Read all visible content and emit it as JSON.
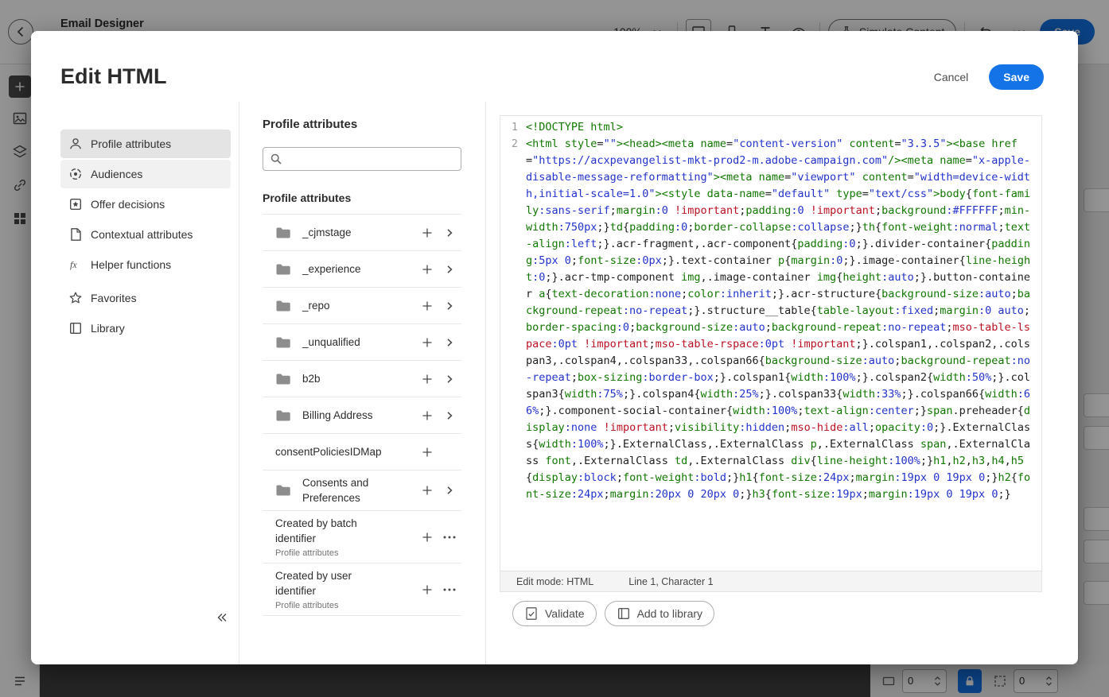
{
  "app_background": {
    "top_bar": {
      "title": "Email Designer",
      "zoom_value": "100%",
      "simulate_button_label": "Simulate Content",
      "save_button_label": "Save"
    },
    "bottom_panel": {
      "field1_value": "0",
      "field2_value": "0"
    }
  },
  "modal": {
    "title": "Edit HTML",
    "cancel_label": "Cancel",
    "save_label": "Save",
    "nav": {
      "primary": [
        {
          "label": "Profile attributes",
          "icon": "user-icon",
          "selected": true,
          "state": ""
        },
        {
          "label": "Audiences",
          "icon": "audiences-icon",
          "selected": false,
          "state": "hover"
        },
        {
          "label": "Offer decisions",
          "icon": "offer-icon",
          "selected": false,
          "state": ""
        },
        {
          "label": "Contextual attributes",
          "icon": "contextual-icon",
          "selected": false,
          "state": ""
        },
        {
          "label": "Helper functions",
          "icon": "fx-icon",
          "selected": false,
          "state": ""
        }
      ],
      "secondary": [
        {
          "label": "Favorites",
          "icon": "star-icon",
          "selected": false,
          "state": ""
        },
        {
          "label": "Library",
          "icon": "library-icon",
          "selected": false,
          "state": ""
        }
      ]
    },
    "attributes_panel": {
      "title": "Profile attributes",
      "list_title": "Profile attributes",
      "items": [
        {
          "label": "_cjmstage",
          "folder": true,
          "actions": [
            "add",
            "open"
          ]
        },
        {
          "label": "_experience",
          "folder": true,
          "actions": [
            "add",
            "open"
          ]
        },
        {
          "label": "_repo",
          "folder": true,
          "actions": [
            "add",
            "open"
          ]
        },
        {
          "label": "_unqualified",
          "folder": true,
          "actions": [
            "add",
            "open"
          ]
        },
        {
          "label": "b2b",
          "folder": true,
          "actions": [
            "add",
            "open"
          ]
        },
        {
          "label": "Billing Address",
          "folder": true,
          "actions": [
            "add",
            "open"
          ]
        },
        {
          "label": "consentPoliciesIDMap",
          "folder": false,
          "actions": [
            "add"
          ]
        },
        {
          "label": "Consents and Preferences",
          "folder": true,
          "actions": [
            "add",
            "open"
          ]
        },
        {
          "label": "Created by batch identifier",
          "sublabel": "Profile attributes",
          "folder": false,
          "actions": [
            "add",
            "more"
          ]
        },
        {
          "label": "Created by user identifier",
          "sublabel": "Profile attributes",
          "folder": false,
          "actions": [
            "add",
            "more"
          ]
        }
      ]
    },
    "editor": {
      "lines": [
        {
          "number": "1",
          "code": "<!DOCTYPE html>"
        },
        {
          "number": "2",
          "code": "<html style=\"\"><head><meta name=\"content-version\" content=\"3.3.5\"><base href=\"https://acxpevangelist-mkt-prod2-m.adobe-campaign.com\"/><meta name=\"x-apple-disable-message-reformatting\"><meta name=\"viewport\" content=\"width=device-width,initial-scale=1.0\"><style data-name=\"default\" type=\"text/css\">body{font-family:sans-serif;margin:0 !important;padding:0 !important;background:#FFFFFF;min-width:750px;}td{padding:0;border-collapse:collapse;}th{font-weight:normal;text-align:left;}.acr-fragment,.acr-component{padding:0;}.divider-container{padding:5px 0;font-size:0px;}.text-container p{margin:0;}.image-container{line-height:0;}.acr-tmp-component img,.image-container img{height:auto;}.button-container a{text-decoration:none;color:inherit;}.acr-structure{background-size:auto;background-repeat:no-repeat;}.structure__table{table-layout:fixed;margin:0 auto;border-spacing:0;background-size:auto;background-repeat:no-repeat;mso-table-lspace:0pt !important;mso-table-rspace:0pt !important;}.colspan1,.colspan2,.colspan3,.colspan4,.colspan33,.colspan66{background-size:auto;background-repeat:no-repeat;box-sizing:border-box;}.colspan1{width:100%;}.colspan2{width:50%;}.colspan3{width:75%;}.colspan4{width:25%;}.colspan33{width:33%;}.colspan66{width:66%;}.component-social-container{width:100%;text-align:center;}span.preheader{display:none !important;visibility:hidden;mso-hide:all;opacity:0;}.ExternalClass{width:100%;}.ExternalClass,.ExternalClass p,.ExternalClass span,.ExternalClass font,.ExternalClass td,.ExternalClass div{line-height:100%;}h1,h2,h3,h4,h5{display:block;font-weight:bold;}h1{font-size:24px;margin:19px 0 19px 0;}h2{font-size:24px;margin:20px 0 20px 0;}h3{font-size:19px;margin:19px 0 19px 0;}"
        }
      ],
      "status": {
        "mode": "Edit mode: HTML",
        "position": "Line 1, Character 1"
      },
      "actions": [
        {
          "label": "Validate",
          "icon": "validate-icon"
        },
        {
          "label": "Add to library",
          "icon": "library-icon"
        }
      ]
    }
  },
  "colors": {
    "accent_blue": "#1473e6",
    "selected_nav_bg": "#e4e4e4",
    "syntax": {
      "tag": "#117700",
      "property": "#117700",
      "string": "#2233cc",
      "value": "#2233cc",
      "important": "#bb1122"
    }
  }
}
